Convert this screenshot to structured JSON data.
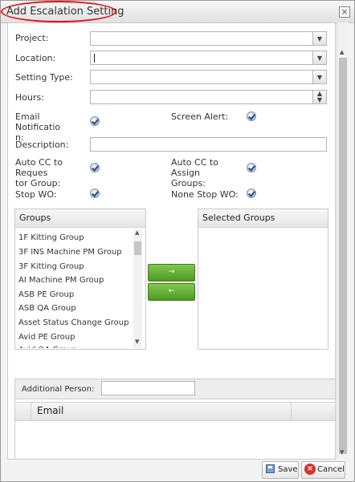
{
  "window": {
    "title": "Add Escalation Setting",
    "close": "×"
  },
  "form": {
    "project": "Project:",
    "location": "Location:",
    "setting_type": "Setting Type:",
    "hours": "Hours:",
    "email_notification": "Email Notificatio\nn:",
    "screen_alert": "Screen Alert:",
    "description": "Description:",
    "auto_cc_requestor": "Auto CC to Reques\ntor Group:",
    "auto_cc_assign": "Auto CC to Assign\nGroups:",
    "stop_wo": "Stop WO:",
    "none_stop_wo": "None Stop WO:"
  },
  "groups": {
    "header": "Groups",
    "items": [
      "1F Kitting Group",
      "3F INS Machine PM Group",
      "3F Kitting Group",
      "AI Machine PM Group",
      "ASB PE Group",
      "ASB QA Group",
      "Asset Status Change Group",
      "Avid PE Group",
      "Avid QA Group"
    ]
  },
  "selected_groups": {
    "header": "Selected Groups"
  },
  "buttons": {
    "move_right": "→",
    "move_left": "←",
    "save": "Save",
    "cancel": "Cancel"
  },
  "additional_person": {
    "label": "Additional Person:",
    "column_email": "Email"
  },
  "icons": {
    "dropdown": "▼",
    "spin_up": "▲",
    "spin_down": "▼",
    "scroll_up": "▲",
    "scroll_down": "▼"
  }
}
